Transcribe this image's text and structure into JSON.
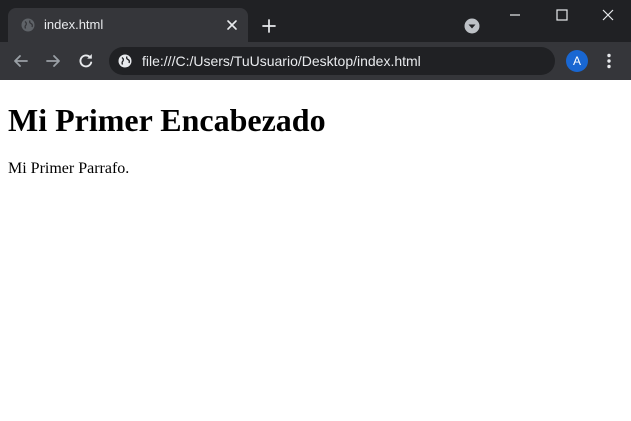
{
  "tab": {
    "title": "index.html",
    "favicon": "globe-icon"
  },
  "window_controls": {
    "minimize": "minimize-icon",
    "maximize": "maximize-icon",
    "close": "close-icon"
  },
  "toolbar": {
    "url": "file:///C:/Users/TuUsuario/Desktop/index.html",
    "site_info_icon": "globe-icon"
  },
  "profile": {
    "initial": "A",
    "color": "#1967d2"
  },
  "page": {
    "heading": "Mi Primer Encabezado",
    "paragraph": "Mi Primer Parrafo."
  },
  "colors": {
    "tabstrip": "#202124",
    "toolbar": "#35363a",
    "omnibox": "#202124",
    "text": "#e8eaed"
  }
}
